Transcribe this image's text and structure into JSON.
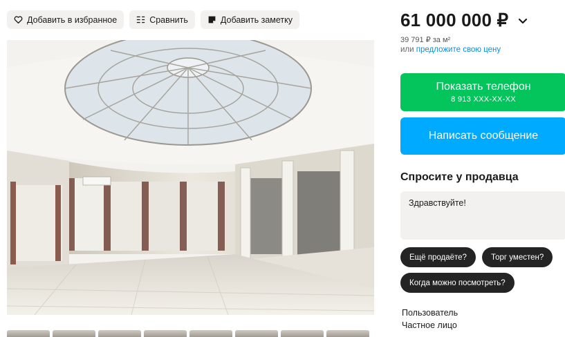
{
  "actions": {
    "favorite_label": "Добавить в избранное",
    "compare_label": "Сравнить",
    "note_label": "Добавить заметку"
  },
  "listing": {
    "price": "61 000 000 ₽",
    "price_per_m2": "39 791 ₽ за м²",
    "offer_prefix": "или",
    "offer_link": "предложите свою цену"
  },
  "contact": {
    "phone_button_label": "Показать телефон",
    "phone_masked": "8 913 XXX-XX-XX",
    "message_button_label": "Написать сообщение",
    "phone_button_color": "#04c45c",
    "message_button_color": "#00aaff"
  },
  "ask": {
    "title": "Спросите у продавца",
    "input_value": "Здравствуйте!",
    "quick_questions": [
      "Ещё продаёте?",
      "Торг уместен?",
      "Когда можно посмотреть?"
    ]
  },
  "seller": {
    "role": "Пользователь",
    "type": "Частное лицо"
  },
  "gallery": {
    "thumbnail_count": 8
  },
  "icons": {
    "favorite": "heart-icon",
    "compare": "compare-icon",
    "note": "note-icon",
    "price_menu": "chevron-down-icon"
  }
}
